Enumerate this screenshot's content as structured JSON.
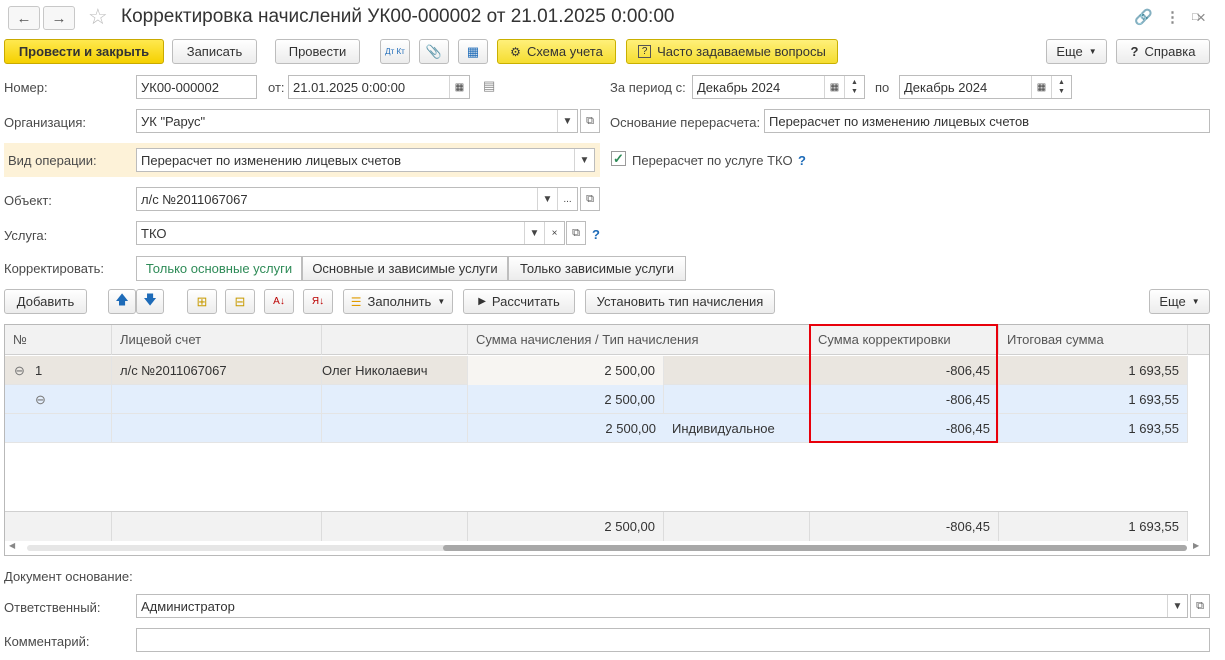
{
  "window": {
    "title": "Корректировка начислений УК00-000002 от 21.01.2025 0:00:00",
    "back_icon": "arrow-left-icon",
    "forward_icon": "arrow-right-icon",
    "star_icon": "star-icon"
  },
  "toolbar": {
    "post_close": "Провести и закрыть",
    "save": "Записать",
    "post": "Провести",
    "scheme": "Схема учета",
    "faq": "Часто задаваемые вопросы",
    "more": "Еще",
    "help": "Справка",
    "dt_kt": "Дт Кт"
  },
  "form": {
    "number_label": "Номер:",
    "number_value": "УК00-000002",
    "from_label": "от:",
    "date_value": "21.01.2025  0:00:00",
    "period_label": "За период с:",
    "period_from": "Декабрь 2024",
    "period_to_label": "по",
    "period_to": "Декабрь 2024",
    "org_label": "Организация:",
    "org_value": "УК \"Рарус\"",
    "reason_label": "Основание перерасчета:",
    "reason_value": "Перерасчет по изменению лицевых счетов",
    "op_label": "Вид операции:",
    "op_value": "Перерасчет по изменению лицевых счетов",
    "tko_label": "Перерасчет по услуге ТКО",
    "object_label": "Объект:",
    "object_value": "л/с №2011067067",
    "service_label": "Услуга:",
    "service_value": "ТКО",
    "correct_label": "Корректировать:",
    "correct_options": [
      "Только основные услуги",
      "Основные и зависимые услуги",
      "Только зависимые услуги"
    ],
    "question": "?"
  },
  "table_toolbar": {
    "add": "Добавить",
    "fill": "Заполнить",
    "calculate": "Рассчитать",
    "set_type": "Установить тип начисления",
    "more": "Еще"
  },
  "table": {
    "headers": [
      "№",
      "Лицевой счет",
      "",
      "Сумма начисления / Тип начисления",
      "Сумма корректировки",
      "Итоговая сумма"
    ],
    "rows": [
      {
        "num": "1",
        "account": "л/с №2011067067",
        "name": "Олег Николаевич",
        "sum": "2 500,00",
        "type": "",
        "corr": "-806,45",
        "total": "1 693,55"
      },
      {
        "num": "",
        "account": "",
        "name": "",
        "sum": "2 500,00",
        "type": "",
        "corr": "-806,45",
        "total": "1 693,55"
      },
      {
        "num": "",
        "account": "",
        "name": "",
        "sum": "2 500,00",
        "type": "Индивидуальное",
        "corr": "-806,45",
        "total": "1 693,55"
      }
    ],
    "footer": {
      "sum": "2 500,00",
      "corr": "-806,45",
      "total": "1 693,55"
    }
  },
  "bottom": {
    "doc_basis_label": "Документ основание:",
    "responsible_label": "Ответственный:",
    "responsible_value": "Администратор",
    "comment_label": "Комментарий:",
    "comment_value": ""
  }
}
